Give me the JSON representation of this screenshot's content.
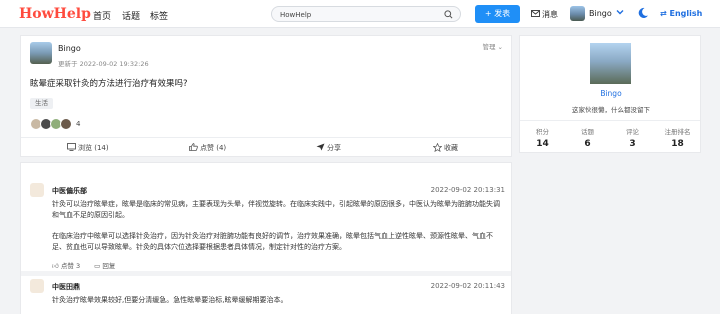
{
  "header": {
    "logo": "HowHelp",
    "nav": [
      "首页",
      "话题",
      "标签"
    ],
    "search_value": "HowHelp",
    "post_button": "+ 发表",
    "messages": "消息",
    "user_name": "Bingo",
    "language": "English",
    "colors": {
      "brand": "#ff4b3e",
      "accent": "#1f8ff7"
    }
  },
  "post": {
    "author": "Bingo",
    "updated": "更新于 2022-09-02 19:32:26",
    "manage": "管理",
    "title": "眩晕症采取针灸的方法进行治疗有效果吗?",
    "tag": "生活",
    "likes_count": "4",
    "actions": {
      "views": "浏览 (14)",
      "likes": "点赞 (4)",
      "share": "分享",
      "favorite": "收藏"
    }
  },
  "answers": [
    {
      "author": "中医偏乐部",
      "date": "2022-09-02 20:13:31",
      "para1": "针灸可以治疗眩晕症，眩晕是临床的常见病，主要表现为头晕，伴视觉旋转。在临床实践中，引起眩晕的原因很多，中医认为眩晕为脏腑功能失调和气血不足的原因引起。",
      "para2": "在临床治疗中眩晕可以选择针灸治疗，因为针灸治疗对脏腑功能有良好的调节，治疗效果准确，眩晕包括气血上逆性眩晕、颈源性眩晕、气血不足、贫血也可以导致眩晕。针灸的具体穴位选择要根据患者具体情况，制定针对性的治疗方案。",
      "like": "点赞 3",
      "reply": "回复"
    },
    {
      "author": "中医田鼎",
      "date": "2022-09-02 20:11:43",
      "para1": "针灸治疗眩晕效果较好,但要分清缓急。急性眩晕要治标,眩晕缓解期要治本。"
    }
  ],
  "profile": {
    "name": "Bingo",
    "bio": "这家伙很懒，什么都没留下",
    "stats": [
      {
        "label": "积分",
        "value": "14"
      },
      {
        "label": "话题",
        "value": "6"
      },
      {
        "label": "评论",
        "value": "3"
      },
      {
        "label": "注册排名",
        "value": "18"
      }
    ]
  }
}
